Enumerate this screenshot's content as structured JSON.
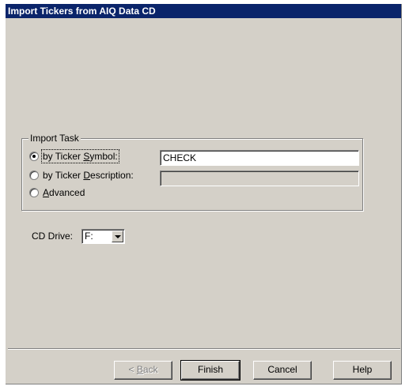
{
  "window": {
    "title": "Import Tickers from AIQ Data CD"
  },
  "import_task": {
    "group_label": "Import Task",
    "options": [
      {
        "label_pre": "by Ticker ",
        "label_key": "S",
        "label_post": "ymbol:",
        "selected": true
      },
      {
        "label_pre": "by Ticker ",
        "label_key": "D",
        "label_post": "escription:",
        "selected": false
      },
      {
        "label_pre": "",
        "label_key": "A",
        "label_post": "dvanced",
        "selected": false
      }
    ],
    "symbol_value": "CHECK",
    "description_value": ""
  },
  "cd_drive": {
    "label": "CD Drive:",
    "selected": "F:"
  },
  "buttons": {
    "back": {
      "prefix": "< ",
      "key": "B",
      "rest": "ack"
    },
    "finish": "Finish",
    "cancel": "Cancel",
    "help": "Help"
  }
}
